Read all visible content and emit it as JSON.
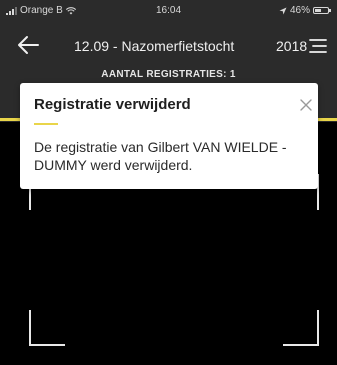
{
  "status_bar": {
    "carrier": "Orange B",
    "time": "16:04",
    "battery": "46%"
  },
  "nav": {
    "title": "12.09 - Nazomerfietstocht",
    "year": "2018",
    "back_icon": "arrow-left-icon",
    "menu_icon": "hamburger-menu-icon"
  },
  "registrations": {
    "label": "AANTAL REGISTRATIES: 1"
  },
  "toast": {
    "title": "Registratie verwijderd",
    "message": "De registratie van Gilbert VAN WIELDE - DUMMY werd verwijderd.",
    "close_icon": "close-icon"
  },
  "colors": {
    "header_bg": "#2b2b2b",
    "accent": "#e9d54a",
    "screen_bg": "#000000",
    "card_bg": "#ffffff"
  }
}
